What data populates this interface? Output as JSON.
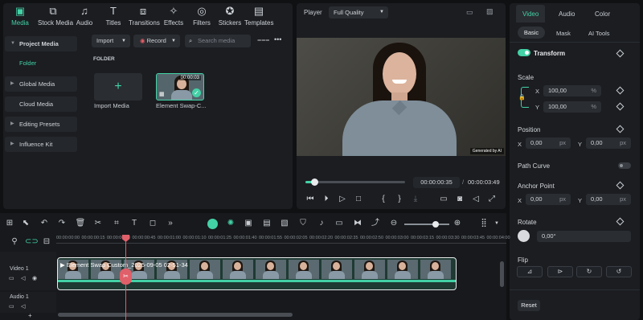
{
  "toolbar": {
    "items": [
      {
        "label": "Media",
        "icon": "media-icon",
        "active": true
      },
      {
        "label": "Stock Media",
        "icon": "stock-media-icon"
      },
      {
        "label": "Audio",
        "icon": "audio-icon"
      },
      {
        "label": "Titles",
        "icon": "titles-icon"
      },
      {
        "label": "Transitions",
        "icon": "transitions-icon"
      },
      {
        "label": "Effects",
        "icon": "effects-icon"
      },
      {
        "label": "Filters",
        "icon": "filters-icon"
      },
      {
        "label": "Stickers",
        "icon": "stickers-icon"
      },
      {
        "label": "Templates",
        "icon": "templates-icon"
      }
    ]
  },
  "sidebar": {
    "project_media": "Project Media",
    "folder": "Folder",
    "global_media": "Global Media",
    "cloud_media": "Cloud Media",
    "editing_presets": "Editing Presets",
    "influence_kit": "Influence Kit"
  },
  "media": {
    "import_label": "Import",
    "record_label": "Record",
    "search_placeholder": "Search media",
    "folder_heading": "FOLDER",
    "import_media_label": "Import Media",
    "clip_name": "Element Swap-C...",
    "clip_duration": "00:00:03"
  },
  "player": {
    "label": "Player",
    "quality": "Full Quality",
    "watermark": "Generated by AI",
    "current_time": "00:00:00:35",
    "total_time": "00:00:03:49",
    "progress_fraction": 0.09
  },
  "timeline": {
    "ruler": [
      "00:00:00:00",
      "00:00:00:15",
      "00:00:00:30",
      "00:00:00:45",
      "00:00:01:00",
      "00:00:01:10",
      "00:00:01:25",
      "00:00:01:40",
      "00:00:01:55",
      "00:00:02:05",
      "00:00:02:20",
      "00:00:02:35",
      "00:00:02:50",
      "00:00:03:00",
      "00:00:03:15",
      "00:00:03:30",
      "00:00:03:45",
      "00:00:04:00"
    ],
    "clip_title": "Element Swap Custom_2025-09-05 02-51-34",
    "video_track": "Video 1",
    "audio_track": "Audio 1"
  },
  "properties": {
    "tabs": [
      "Video",
      "Audio",
      "Color"
    ],
    "subtabs": [
      "Basic",
      "Mask",
      "AI Tools"
    ],
    "transform": "Transform",
    "scale": "Scale",
    "scale_x": "100,00",
    "scale_y": "100,00",
    "percent": "%",
    "position": "Position",
    "pos_x": "0,00",
    "pos_y": "0,00",
    "px": "px",
    "path_curve": "Path Curve",
    "anchor_point": "Anchor Point",
    "anchor_x": "0,00",
    "anchor_y": "0,00",
    "rotate": "Rotate",
    "rotate_value": "0,00°",
    "flip": "Flip",
    "reset": "Reset",
    "x": "X",
    "y": "Y"
  },
  "colors": {
    "accent": "#43d1a6",
    "playhead": "#e0606a",
    "panel": "#1b1d21",
    "bg": "#0f1113"
  }
}
